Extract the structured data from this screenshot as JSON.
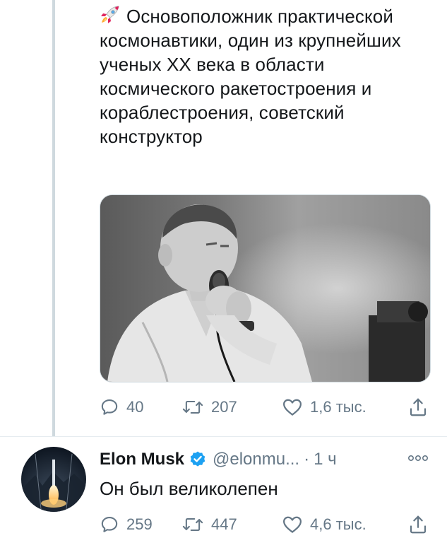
{
  "tweet": {
    "emoji_icon": "rocket-icon",
    "text": "Основоположник практической космонавтики, один из крупнейших ученых XX века в области космического ракетостроения и кораблестроения, советский конструктор",
    "stats": {
      "replies": "40",
      "retweets": "207",
      "likes": "1,6 тыс."
    }
  },
  "reply": {
    "author_name": "Elon Musk",
    "handle": "@elonmu...",
    "dot": "·",
    "time": "1 ч",
    "text": "Он был великолепен",
    "stats": {
      "replies": "259",
      "retweets": "447",
      "likes": "4,6 тыс."
    }
  },
  "colors": {
    "text": "#14171a",
    "muted": "#657786",
    "thread_line": "#cfd9de",
    "verified": "#1da1f2"
  }
}
